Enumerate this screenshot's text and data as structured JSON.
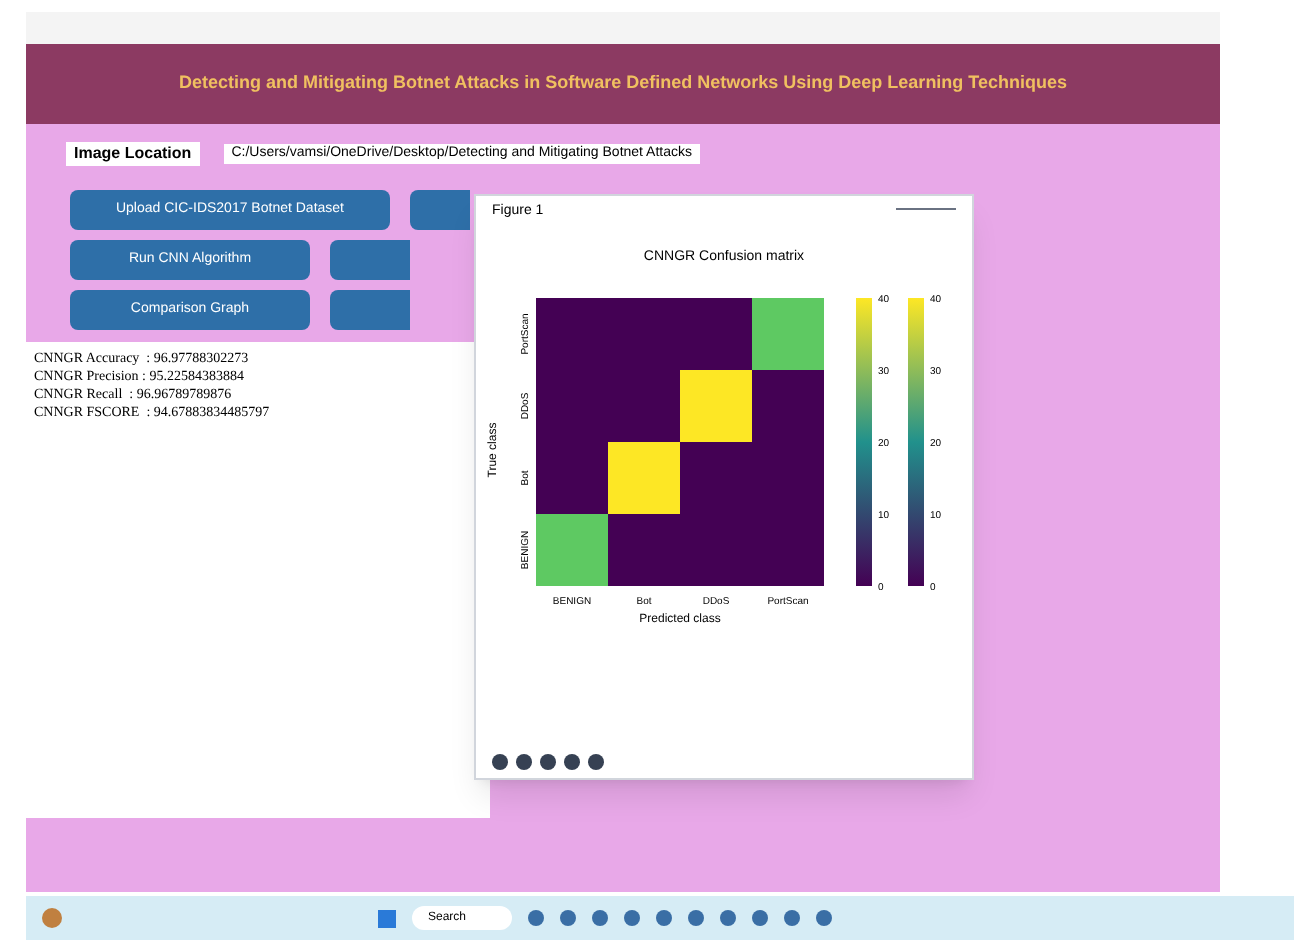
{
  "header": {
    "title": "Detecting and Mitigating Botnet Attacks in Software Defined Networks Using Deep Learning Techniques"
  },
  "location": {
    "label": "Image Location",
    "value": "C:/Users/vamsi/OneDrive/Desktop/Detecting and Mitigating Botnet Attacks"
  },
  "buttons": [
    {
      "label": "Upload CIC-IDS2017 Botnet Dataset"
    },
    {
      "label": "Run CNN Algorithm"
    },
    {
      "label": "Comparison Graph"
    }
  ],
  "results": [
    "CNNGR Accuracy  : 96.97788302273",
    "CNNGR Precision : 95.22584383884",
    "CNNGR Recall  : 96.96789789876",
    "CNNGR FSCORE  : 94.67883834485797"
  ],
  "figure": {
    "title": "Figure 1",
    "plot_title": "CNNGR Confusion matrix",
    "xlabel": "Predicted class",
    "ylabel": "True class",
    "x_classes": [
      "BENIGN",
      "Bot",
      "DDoS",
      "PortScan"
    ],
    "y_classes": [
      "PortScan",
      "DDoS",
      "Bot",
      "BENIGN"
    ],
    "colorbars": [
      {
        "ticks": [
          "40",
          "30",
          "20",
          "10",
          "0"
        ]
      },
      {
        "ticks": [
          "40",
          "30",
          "20",
          "10",
          "0"
        ]
      }
    ]
  },
  "taskbar": {
    "search": "Search"
  }
}
